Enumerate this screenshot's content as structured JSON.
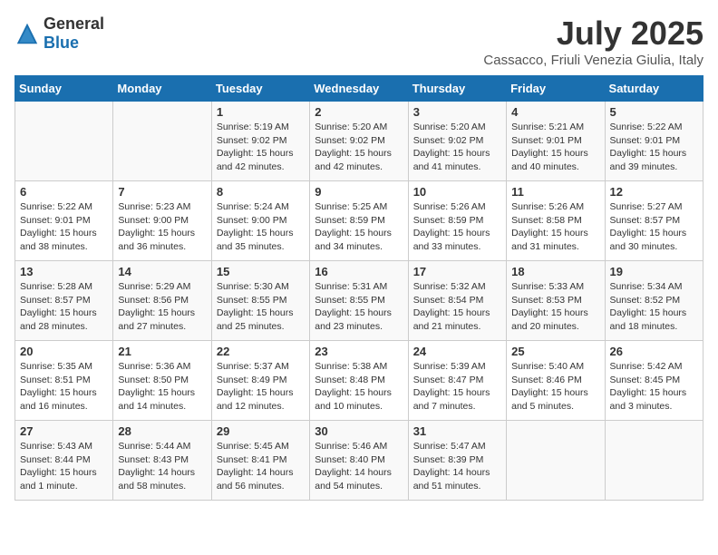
{
  "logo": {
    "general": "General",
    "blue": "Blue"
  },
  "header": {
    "title": "July 2025",
    "subtitle": "Cassacco, Friuli Venezia Giulia, Italy"
  },
  "weekdays": [
    "Sunday",
    "Monday",
    "Tuesday",
    "Wednesday",
    "Thursday",
    "Friday",
    "Saturday"
  ],
  "weeks": [
    [
      {
        "day": "",
        "sunrise": "",
        "sunset": "",
        "daylight": ""
      },
      {
        "day": "",
        "sunrise": "",
        "sunset": "",
        "daylight": ""
      },
      {
        "day": "1",
        "sunrise": "Sunrise: 5:19 AM",
        "sunset": "Sunset: 9:02 PM",
        "daylight": "Daylight: 15 hours and 42 minutes."
      },
      {
        "day": "2",
        "sunrise": "Sunrise: 5:20 AM",
        "sunset": "Sunset: 9:02 PM",
        "daylight": "Daylight: 15 hours and 42 minutes."
      },
      {
        "day": "3",
        "sunrise": "Sunrise: 5:20 AM",
        "sunset": "Sunset: 9:02 PM",
        "daylight": "Daylight: 15 hours and 41 minutes."
      },
      {
        "day": "4",
        "sunrise": "Sunrise: 5:21 AM",
        "sunset": "Sunset: 9:01 PM",
        "daylight": "Daylight: 15 hours and 40 minutes."
      },
      {
        "day": "5",
        "sunrise": "Sunrise: 5:22 AM",
        "sunset": "Sunset: 9:01 PM",
        "daylight": "Daylight: 15 hours and 39 minutes."
      }
    ],
    [
      {
        "day": "6",
        "sunrise": "Sunrise: 5:22 AM",
        "sunset": "Sunset: 9:01 PM",
        "daylight": "Daylight: 15 hours and 38 minutes."
      },
      {
        "day": "7",
        "sunrise": "Sunrise: 5:23 AM",
        "sunset": "Sunset: 9:00 PM",
        "daylight": "Daylight: 15 hours and 36 minutes."
      },
      {
        "day": "8",
        "sunrise": "Sunrise: 5:24 AM",
        "sunset": "Sunset: 9:00 PM",
        "daylight": "Daylight: 15 hours and 35 minutes."
      },
      {
        "day": "9",
        "sunrise": "Sunrise: 5:25 AM",
        "sunset": "Sunset: 8:59 PM",
        "daylight": "Daylight: 15 hours and 34 minutes."
      },
      {
        "day": "10",
        "sunrise": "Sunrise: 5:26 AM",
        "sunset": "Sunset: 8:59 PM",
        "daylight": "Daylight: 15 hours and 33 minutes."
      },
      {
        "day": "11",
        "sunrise": "Sunrise: 5:26 AM",
        "sunset": "Sunset: 8:58 PM",
        "daylight": "Daylight: 15 hours and 31 minutes."
      },
      {
        "day": "12",
        "sunrise": "Sunrise: 5:27 AM",
        "sunset": "Sunset: 8:57 PM",
        "daylight": "Daylight: 15 hours and 30 minutes."
      }
    ],
    [
      {
        "day": "13",
        "sunrise": "Sunrise: 5:28 AM",
        "sunset": "Sunset: 8:57 PM",
        "daylight": "Daylight: 15 hours and 28 minutes."
      },
      {
        "day": "14",
        "sunrise": "Sunrise: 5:29 AM",
        "sunset": "Sunset: 8:56 PM",
        "daylight": "Daylight: 15 hours and 27 minutes."
      },
      {
        "day": "15",
        "sunrise": "Sunrise: 5:30 AM",
        "sunset": "Sunset: 8:55 PM",
        "daylight": "Daylight: 15 hours and 25 minutes."
      },
      {
        "day": "16",
        "sunrise": "Sunrise: 5:31 AM",
        "sunset": "Sunset: 8:55 PM",
        "daylight": "Daylight: 15 hours and 23 minutes."
      },
      {
        "day": "17",
        "sunrise": "Sunrise: 5:32 AM",
        "sunset": "Sunset: 8:54 PM",
        "daylight": "Daylight: 15 hours and 21 minutes."
      },
      {
        "day": "18",
        "sunrise": "Sunrise: 5:33 AM",
        "sunset": "Sunset: 8:53 PM",
        "daylight": "Daylight: 15 hours and 20 minutes."
      },
      {
        "day": "19",
        "sunrise": "Sunrise: 5:34 AM",
        "sunset": "Sunset: 8:52 PM",
        "daylight": "Daylight: 15 hours and 18 minutes."
      }
    ],
    [
      {
        "day": "20",
        "sunrise": "Sunrise: 5:35 AM",
        "sunset": "Sunset: 8:51 PM",
        "daylight": "Daylight: 15 hours and 16 minutes."
      },
      {
        "day": "21",
        "sunrise": "Sunrise: 5:36 AM",
        "sunset": "Sunset: 8:50 PM",
        "daylight": "Daylight: 15 hours and 14 minutes."
      },
      {
        "day": "22",
        "sunrise": "Sunrise: 5:37 AM",
        "sunset": "Sunset: 8:49 PM",
        "daylight": "Daylight: 15 hours and 12 minutes."
      },
      {
        "day": "23",
        "sunrise": "Sunrise: 5:38 AM",
        "sunset": "Sunset: 8:48 PM",
        "daylight": "Daylight: 15 hours and 10 minutes."
      },
      {
        "day": "24",
        "sunrise": "Sunrise: 5:39 AM",
        "sunset": "Sunset: 8:47 PM",
        "daylight": "Daylight: 15 hours and 7 minutes."
      },
      {
        "day": "25",
        "sunrise": "Sunrise: 5:40 AM",
        "sunset": "Sunset: 8:46 PM",
        "daylight": "Daylight: 15 hours and 5 minutes."
      },
      {
        "day": "26",
        "sunrise": "Sunrise: 5:42 AM",
        "sunset": "Sunset: 8:45 PM",
        "daylight": "Daylight: 15 hours and 3 minutes."
      }
    ],
    [
      {
        "day": "27",
        "sunrise": "Sunrise: 5:43 AM",
        "sunset": "Sunset: 8:44 PM",
        "daylight": "Daylight: 15 hours and 1 minute."
      },
      {
        "day": "28",
        "sunrise": "Sunrise: 5:44 AM",
        "sunset": "Sunset: 8:43 PM",
        "daylight": "Daylight: 14 hours and 58 minutes."
      },
      {
        "day": "29",
        "sunrise": "Sunrise: 5:45 AM",
        "sunset": "Sunset: 8:41 PM",
        "daylight": "Daylight: 14 hours and 56 minutes."
      },
      {
        "day": "30",
        "sunrise": "Sunrise: 5:46 AM",
        "sunset": "Sunset: 8:40 PM",
        "daylight": "Daylight: 14 hours and 54 minutes."
      },
      {
        "day": "31",
        "sunrise": "Sunrise: 5:47 AM",
        "sunset": "Sunset: 8:39 PM",
        "daylight": "Daylight: 14 hours and 51 minutes."
      },
      {
        "day": "",
        "sunrise": "",
        "sunset": "",
        "daylight": ""
      },
      {
        "day": "",
        "sunrise": "",
        "sunset": "",
        "daylight": ""
      }
    ]
  ]
}
